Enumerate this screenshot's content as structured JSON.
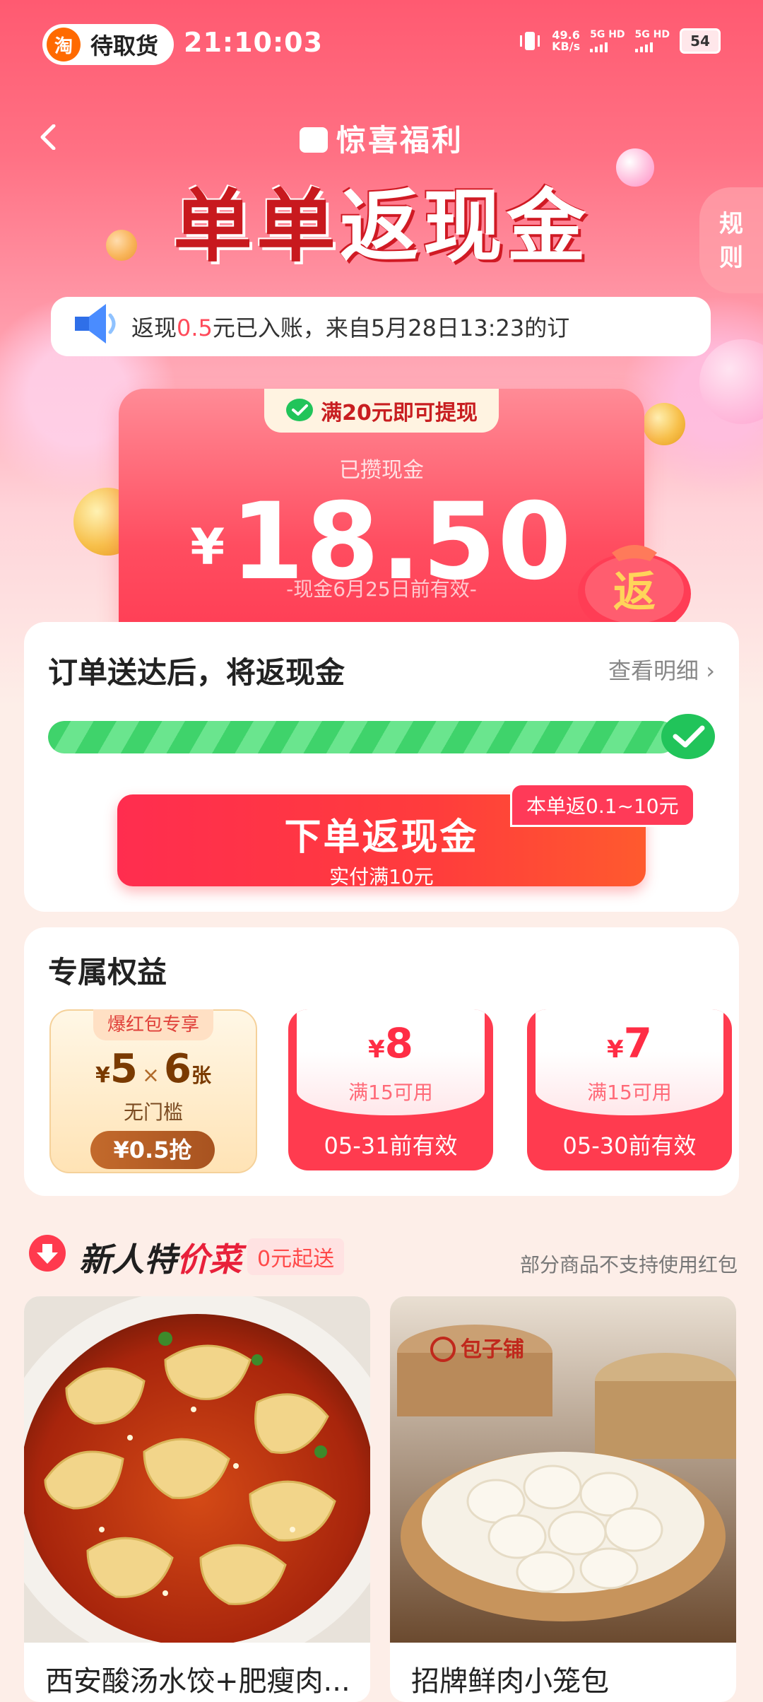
{
  "status_bar": {
    "pill_text": "待取货",
    "taobao_char": "淘",
    "time": "21:10:03",
    "net_speed_value": "49.6",
    "net_speed_unit": "KB/s",
    "signal_1": "5G HD",
    "signal_2": "5G HD",
    "battery": "54"
  },
  "header": {
    "brand": "惊喜福利",
    "title_part1": "单单",
    "title_part2": "返现金",
    "rules": "规则"
  },
  "notice": {
    "prefix": "返现",
    "amount": "0.5",
    "suffix": "元已入账，来自5月28日13:23的订"
  },
  "cash": {
    "tag": "满20元即可提现",
    "label": "已攒现金",
    "currency": "¥",
    "amount": "18.50",
    "expiry": "-现金6月25日前有效-"
  },
  "progress": {
    "title": "订单送达后，将返现金",
    "detail_link": "查看明细 ›",
    "fill_percent": 100,
    "cta_main": "下单返现金",
    "cta_sub": "实付满10元",
    "cta_badge": "本单返0.1~10元"
  },
  "benefits": {
    "title": "专属权益",
    "special": {
      "tag": "爆红包专享",
      "currency": "¥",
      "value": "5",
      "times": "×",
      "count": "6",
      "unit": "张",
      "note": "无门槛",
      "button": "¥0.5抢"
    },
    "coupons": [
      {
        "currency": "¥",
        "value": "8",
        "condition": "满15可用",
        "valid": "05-31前有效"
      },
      {
        "currency": "¥",
        "value": "7",
        "condition": "满15可用",
        "valid": "05-30前有效"
      }
    ]
  },
  "new_user": {
    "title_part1": "新人特",
    "title_part2": "价菜",
    "badge": "0元起送",
    "note": "部分商品不支持使用红包",
    "products": [
      {
        "name": "西安酸汤水饺+肥瘦肉..."
      },
      {
        "name": "招牌鲜肉小笼包",
        "brand_logo_text": "包子铺"
      }
    ]
  },
  "colors": {
    "accent": "#ff3b53",
    "dark_red": "#c8191e",
    "progress_green": "#3fd36b"
  }
}
